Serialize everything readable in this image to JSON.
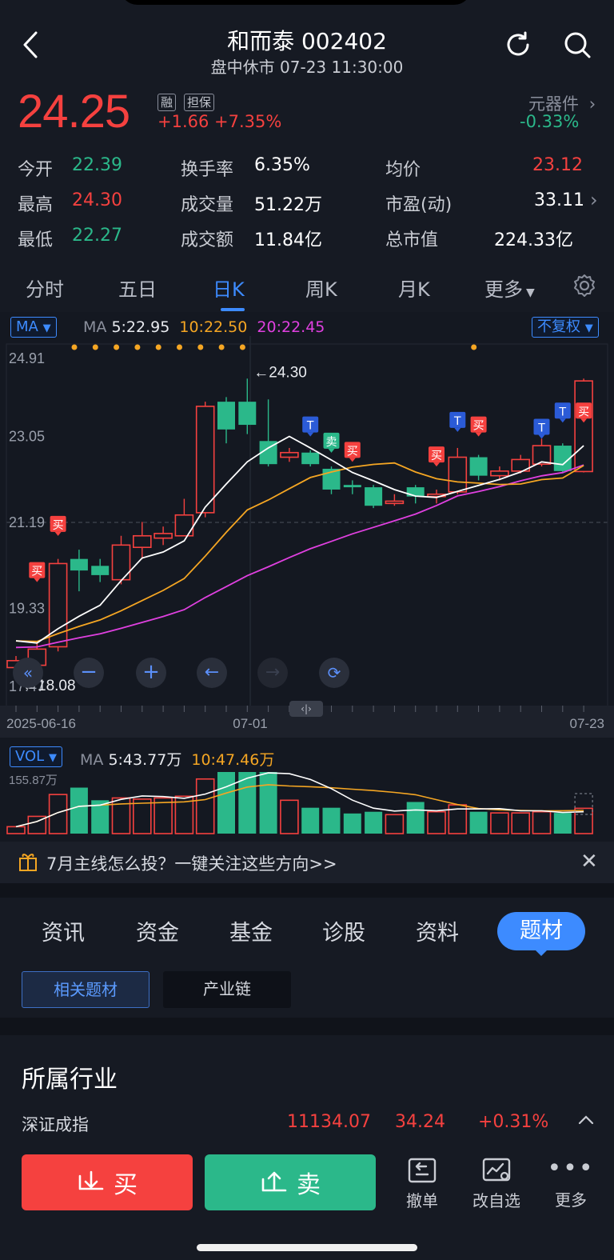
{
  "header": {
    "title": "和而泰 002402",
    "subtitle": "盘中休市 07-23 11:30:00"
  },
  "quote": {
    "price": "24.25",
    "tag1": "融",
    "tag2": "担保",
    "change": "+1.66",
    "change_pct": "+7.35%",
    "sector_name": "元器件",
    "sector_change": "-0.33%"
  },
  "stats": {
    "open_label": "今开",
    "open": "22.39",
    "high_label": "最高",
    "high": "24.30",
    "low_label": "最低",
    "low": "22.27",
    "turnover_label": "换手率",
    "turnover": "6.35%",
    "volume_label": "成交量",
    "volume": "51.22万",
    "amount_label": "成交额",
    "amount": "11.84亿",
    "avg_label": "均价",
    "avg": "23.12",
    "pe_label": "市盈(动)",
    "pe": "33.11",
    "mcap_label": "总市值",
    "mcap": "224.33亿"
  },
  "tabs": [
    "分时",
    "五日",
    "日K",
    "周K",
    "月K",
    "更多"
  ],
  "chart": {
    "indicator": "MA",
    "ma_title": "MA",
    "ma5": "5:22.95",
    "ma10": "10:22.50",
    "ma20": "20:22.45",
    "adjust": "不复权",
    "y_labels": [
      "24.91",
      "23.05",
      "21.19",
      "19.33",
      "17.47"
    ],
    "high_marker": "←24.30",
    "low_marker": "←18.08",
    "x_labels": [
      "2025-06-16",
      "07-01",
      "07-23"
    ],
    "vol_indicator": "VOL",
    "vol_ma_title": "MA",
    "vol_ma5": "5:43.77万",
    "vol_ma10": "10:47.46万",
    "vol_max": "155.87万",
    "signal_buy": "买",
    "signal_sell": "卖",
    "signal_t": "T"
  },
  "chart_data": {
    "type": "candlestick",
    "dates_first": "2025-06-16",
    "dates_last": "07-23",
    "candles": [
      {
        "o": 18.2,
        "c": 18.05,
        "h": 18.3,
        "l": 17.9,
        "dir": "up"
      },
      {
        "o": 18.1,
        "c": 18.45,
        "h": 18.6,
        "l": 18.0,
        "dir": "up"
      },
      {
        "o": 18.5,
        "c": 20.3,
        "h": 20.4,
        "l": 18.4,
        "dir": "up"
      },
      {
        "o": 20.4,
        "c": 20.15,
        "h": 20.6,
        "l": 19.7,
        "dir": "down"
      },
      {
        "o": 20.25,
        "c": 20.05,
        "h": 20.4,
        "l": 19.9,
        "dir": "down"
      },
      {
        "o": 19.95,
        "c": 20.7,
        "h": 20.9,
        "l": 19.85,
        "dir": "up"
      },
      {
        "o": 20.65,
        "c": 20.9,
        "h": 21.2,
        "l": 20.4,
        "dir": "up"
      },
      {
        "o": 20.85,
        "c": 20.95,
        "h": 21.1,
        "l": 20.7,
        "dir": "up"
      },
      {
        "o": 20.9,
        "c": 21.35,
        "h": 21.7,
        "l": 20.9,
        "dir": "up"
      },
      {
        "o": 21.4,
        "c": 23.7,
        "h": 23.8,
        "l": 21.3,
        "dir": "up"
      },
      {
        "o": 23.8,
        "c": 23.2,
        "h": 23.9,
        "l": 22.9,
        "dir": "down"
      },
      {
        "o": 23.8,
        "c": 23.3,
        "h": 24.3,
        "l": 23.1,
        "dir": "down"
      },
      {
        "o": 22.95,
        "c": 22.45,
        "h": 23.85,
        "l": 22.4,
        "dir": "down"
      },
      {
        "o": 22.7,
        "c": 22.6,
        "h": 22.8,
        "l": 22.5,
        "dir": "up"
      },
      {
        "o": 22.7,
        "c": 22.45,
        "h": 22.75,
        "l": 22.4,
        "dir": "down"
      },
      {
        "o": 22.35,
        "c": 21.9,
        "h": 22.4,
        "l": 21.8,
        "dir": "down"
      },
      {
        "o": 22.0,
        "c": 21.95,
        "h": 22.1,
        "l": 21.8,
        "dir": "down"
      },
      {
        "o": 21.95,
        "c": 21.55,
        "h": 22.0,
        "l": 21.5,
        "dir": "down"
      },
      {
        "o": 21.6,
        "c": 21.65,
        "h": 21.8,
        "l": 21.55,
        "dir": "up"
      },
      {
        "o": 21.95,
        "c": 21.75,
        "h": 22.0,
        "l": 21.6,
        "dir": "down"
      },
      {
        "o": 21.8,
        "c": 21.75,
        "h": 21.9,
        "l": 21.6,
        "dir": "up"
      },
      {
        "o": 21.85,
        "c": 22.6,
        "h": 22.8,
        "l": 21.8,
        "dir": "up"
      },
      {
        "o": 22.6,
        "c": 22.2,
        "h": 22.65,
        "l": 22.1,
        "dir": "down"
      },
      {
        "o": 22.2,
        "c": 22.3,
        "h": 22.4,
        "l": 22.1,
        "dir": "up"
      },
      {
        "o": 22.3,
        "c": 22.55,
        "h": 22.65,
        "l": 22.25,
        "dir": "up"
      },
      {
        "o": 22.45,
        "c": 22.85,
        "h": 23.0,
        "l": 22.4,
        "dir": "up"
      },
      {
        "o": 22.85,
        "c": 22.3,
        "h": 22.9,
        "l": 22.25,
        "dir": "down"
      },
      {
        "o": 22.29,
        "c": 24.25,
        "h": 24.3,
        "l": 22.27,
        "dir": "up"
      }
    ],
    "volume_max_wan": 155.87,
    "volumes": [
      12,
      30,
      68,
      80,
      58,
      62,
      60,
      62,
      65,
      95,
      125,
      135,
      108,
      58,
      45,
      45,
      35,
      38,
      33,
      55,
      38,
      50,
      38,
      36,
      36,
      38,
      36,
      44
    ]
  },
  "banner": {
    "text": "7月主线怎么投？一键关注这些方向>>"
  },
  "subtabs": [
    "资讯",
    "资金",
    "基金",
    "诊股",
    "资料",
    "题材"
  ],
  "chips": [
    "相关题材",
    "产业链"
  ],
  "industry": {
    "heading": "所属行业",
    "name": "深证成指",
    "value": "11134.07",
    "change": "34.24",
    "change_pct": "+0.31%"
  },
  "bottom": {
    "buy": "买",
    "sell": "卖",
    "cancel": "撤单",
    "edit_watch": "改自选",
    "more": "更多"
  }
}
